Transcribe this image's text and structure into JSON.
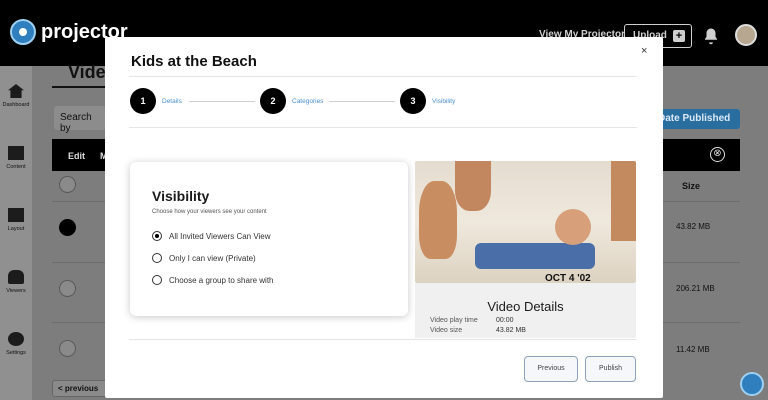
{
  "app": {
    "name": "projector"
  },
  "header": {
    "view_link": "View My Projector",
    "upload_label": "Upload",
    "upload_plus": "+"
  },
  "sidebar": {
    "items": [
      {
        "label": "Dashboard"
      },
      {
        "label": "Content"
      },
      {
        "label": "Layout"
      },
      {
        "label": "Viewers"
      },
      {
        "label": "Settings"
      }
    ]
  },
  "background_page": {
    "title": "Video",
    "search_placeholder": "Search by",
    "table_head": {
      "edit": "Edit",
      "m": "M"
    },
    "sort_button": "Date Published",
    "clear_icon": "⊗",
    "size_header": "Size",
    "rows": [
      {
        "size": "43.82 MB"
      },
      {
        "size": "206.21 MB"
      },
      {
        "size": "11.42 MB"
      }
    ],
    "prev_button": "< previous"
  },
  "modal": {
    "title": "Kids at the Beach",
    "close": "×",
    "steps": [
      {
        "number": "1",
        "label": "Details"
      },
      {
        "number": "2",
        "label": "Categories"
      },
      {
        "number": "3",
        "label": "Visibility"
      }
    ],
    "visibility": {
      "title": "Visibility",
      "subtitle": "Choose how your viewers see your content",
      "options": [
        {
          "label": "All Invited Viewers Can View",
          "checked": true
        },
        {
          "label": "Only I can view (Private)",
          "checked": false
        },
        {
          "label": "Choose a group to share with",
          "checked": false
        }
      ]
    },
    "video": {
      "thumb_text": "OCT  4 '02",
      "details_title": "Video Details",
      "play_time_label": "Video play time",
      "play_time_value": "00:00",
      "size_label": "Video size",
      "size_value": "43.82 MB"
    },
    "buttons": {
      "previous": "Previous",
      "publish": "Publish"
    }
  }
}
